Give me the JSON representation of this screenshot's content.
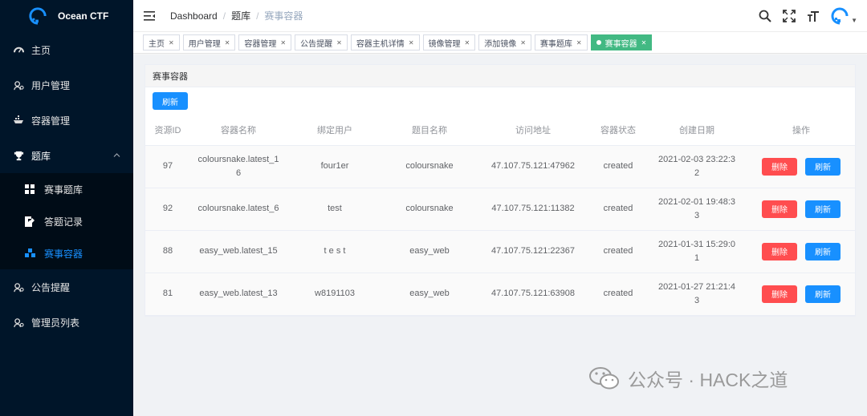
{
  "app": {
    "title": "Ocean CTF"
  },
  "sidebar": {
    "items": [
      {
        "label": "主页",
        "icon": "dashboard-icon"
      },
      {
        "label": "用户管理",
        "icon": "user-icon"
      },
      {
        "label": "容器管理",
        "icon": "container-icon"
      },
      {
        "label": "题库",
        "icon": "trophy-icon",
        "expanded": true
      },
      {
        "label": "公告提醒",
        "icon": "user-icon"
      },
      {
        "label": "管理员列表",
        "icon": "user-icon"
      }
    ],
    "sub_items": [
      {
        "label": "赛事题库",
        "icon": "grid-icon"
      },
      {
        "label": "答题记录",
        "icon": "edit-doc-icon"
      },
      {
        "label": "赛事容器",
        "icon": "cubes-icon",
        "active": true
      }
    ]
  },
  "header": {
    "breadcrumb": [
      "Dashboard",
      "题库",
      "赛事容器"
    ]
  },
  "tags": [
    {
      "label": "主页"
    },
    {
      "label": "用户管理"
    },
    {
      "label": "容器管理"
    },
    {
      "label": "公告提醒"
    },
    {
      "label": "容器主机详情"
    },
    {
      "label": "镜像管理"
    },
    {
      "label": "添加镜像"
    },
    {
      "label": "赛事题库"
    },
    {
      "label": "赛事容器",
      "active": true
    }
  ],
  "card": {
    "title": "赛事容器",
    "refresh_label": "刷新",
    "columns": [
      "资源ID",
      "容器名称",
      "绑定用户",
      "题目名称",
      "访问地址",
      "容器状态",
      "创建日期",
      "操作"
    ],
    "delete_label": "删除",
    "row_refresh_label": "刷新",
    "rows": [
      {
        "id": "97",
        "name": "coloursnake.latest_16",
        "user": "four1er",
        "challenge": "coloursnake",
        "address": "47.107.75.121:47962",
        "status": "created",
        "created": "2021-02-03 23:22:32"
      },
      {
        "id": "92",
        "name": "coloursnake.latest_6",
        "user": "test",
        "challenge": "coloursnake",
        "address": "47.107.75.121:11382",
        "status": "created",
        "created": "2021-02-01 19:48:33"
      },
      {
        "id": "88",
        "name": "easy_web.latest_15",
        "user": "t e s t",
        "challenge": "easy_web",
        "address": "47.107.75.121:22367",
        "status": "created",
        "created": "2021-01-31 15:29:01"
      },
      {
        "id": "81",
        "name": "easy_web.latest_13",
        "user": "w8191103",
        "challenge": "easy_web",
        "address": "47.107.75.121:63908",
        "status": "created",
        "created": "2021-01-27 21:21:43"
      }
    ]
  },
  "watermark": {
    "text": "公众号 · HACK之道"
  },
  "colors": {
    "sidebar_bg": "#001529",
    "primary": "#1890ff",
    "danger": "#ff4d4f",
    "active_tag": "#42b983"
  }
}
